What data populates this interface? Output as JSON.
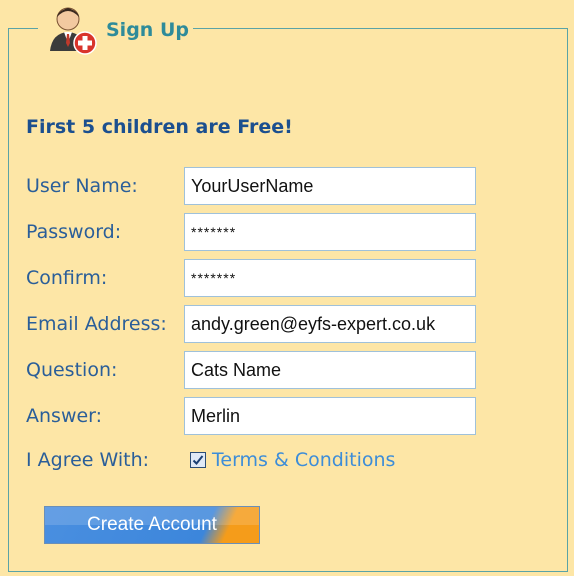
{
  "legend": {
    "title": "Sign Up",
    "icon": "user-add-icon"
  },
  "headline": "First 5 children are Free!",
  "fields": [
    {
      "label": "User Name:",
      "value": "YourUserName"
    },
    {
      "label": "Password:",
      "value": "*******"
    },
    {
      "label": "Confirm:",
      "value": "*******"
    },
    {
      "label": "Email Address:",
      "value": "andy.green@eyfs-expert.co.uk"
    },
    {
      "label": "Question:",
      "value": "Cats Name"
    },
    {
      "label": "Answer:",
      "value": "Merlin"
    }
  ],
  "agree": {
    "label": "I Agree With:",
    "checked": true,
    "link_text": "Terms & Conditions"
  },
  "button": {
    "label": "Create Account"
  },
  "colors": {
    "panel_bg": "#fde6a6",
    "headline": "#1b4f8f",
    "label": "#2a5e99",
    "legend": "#2e8b9a",
    "link": "#3d8dd8",
    "button_blue": "#3c86db",
    "button_orange": "#f59c1a"
  }
}
